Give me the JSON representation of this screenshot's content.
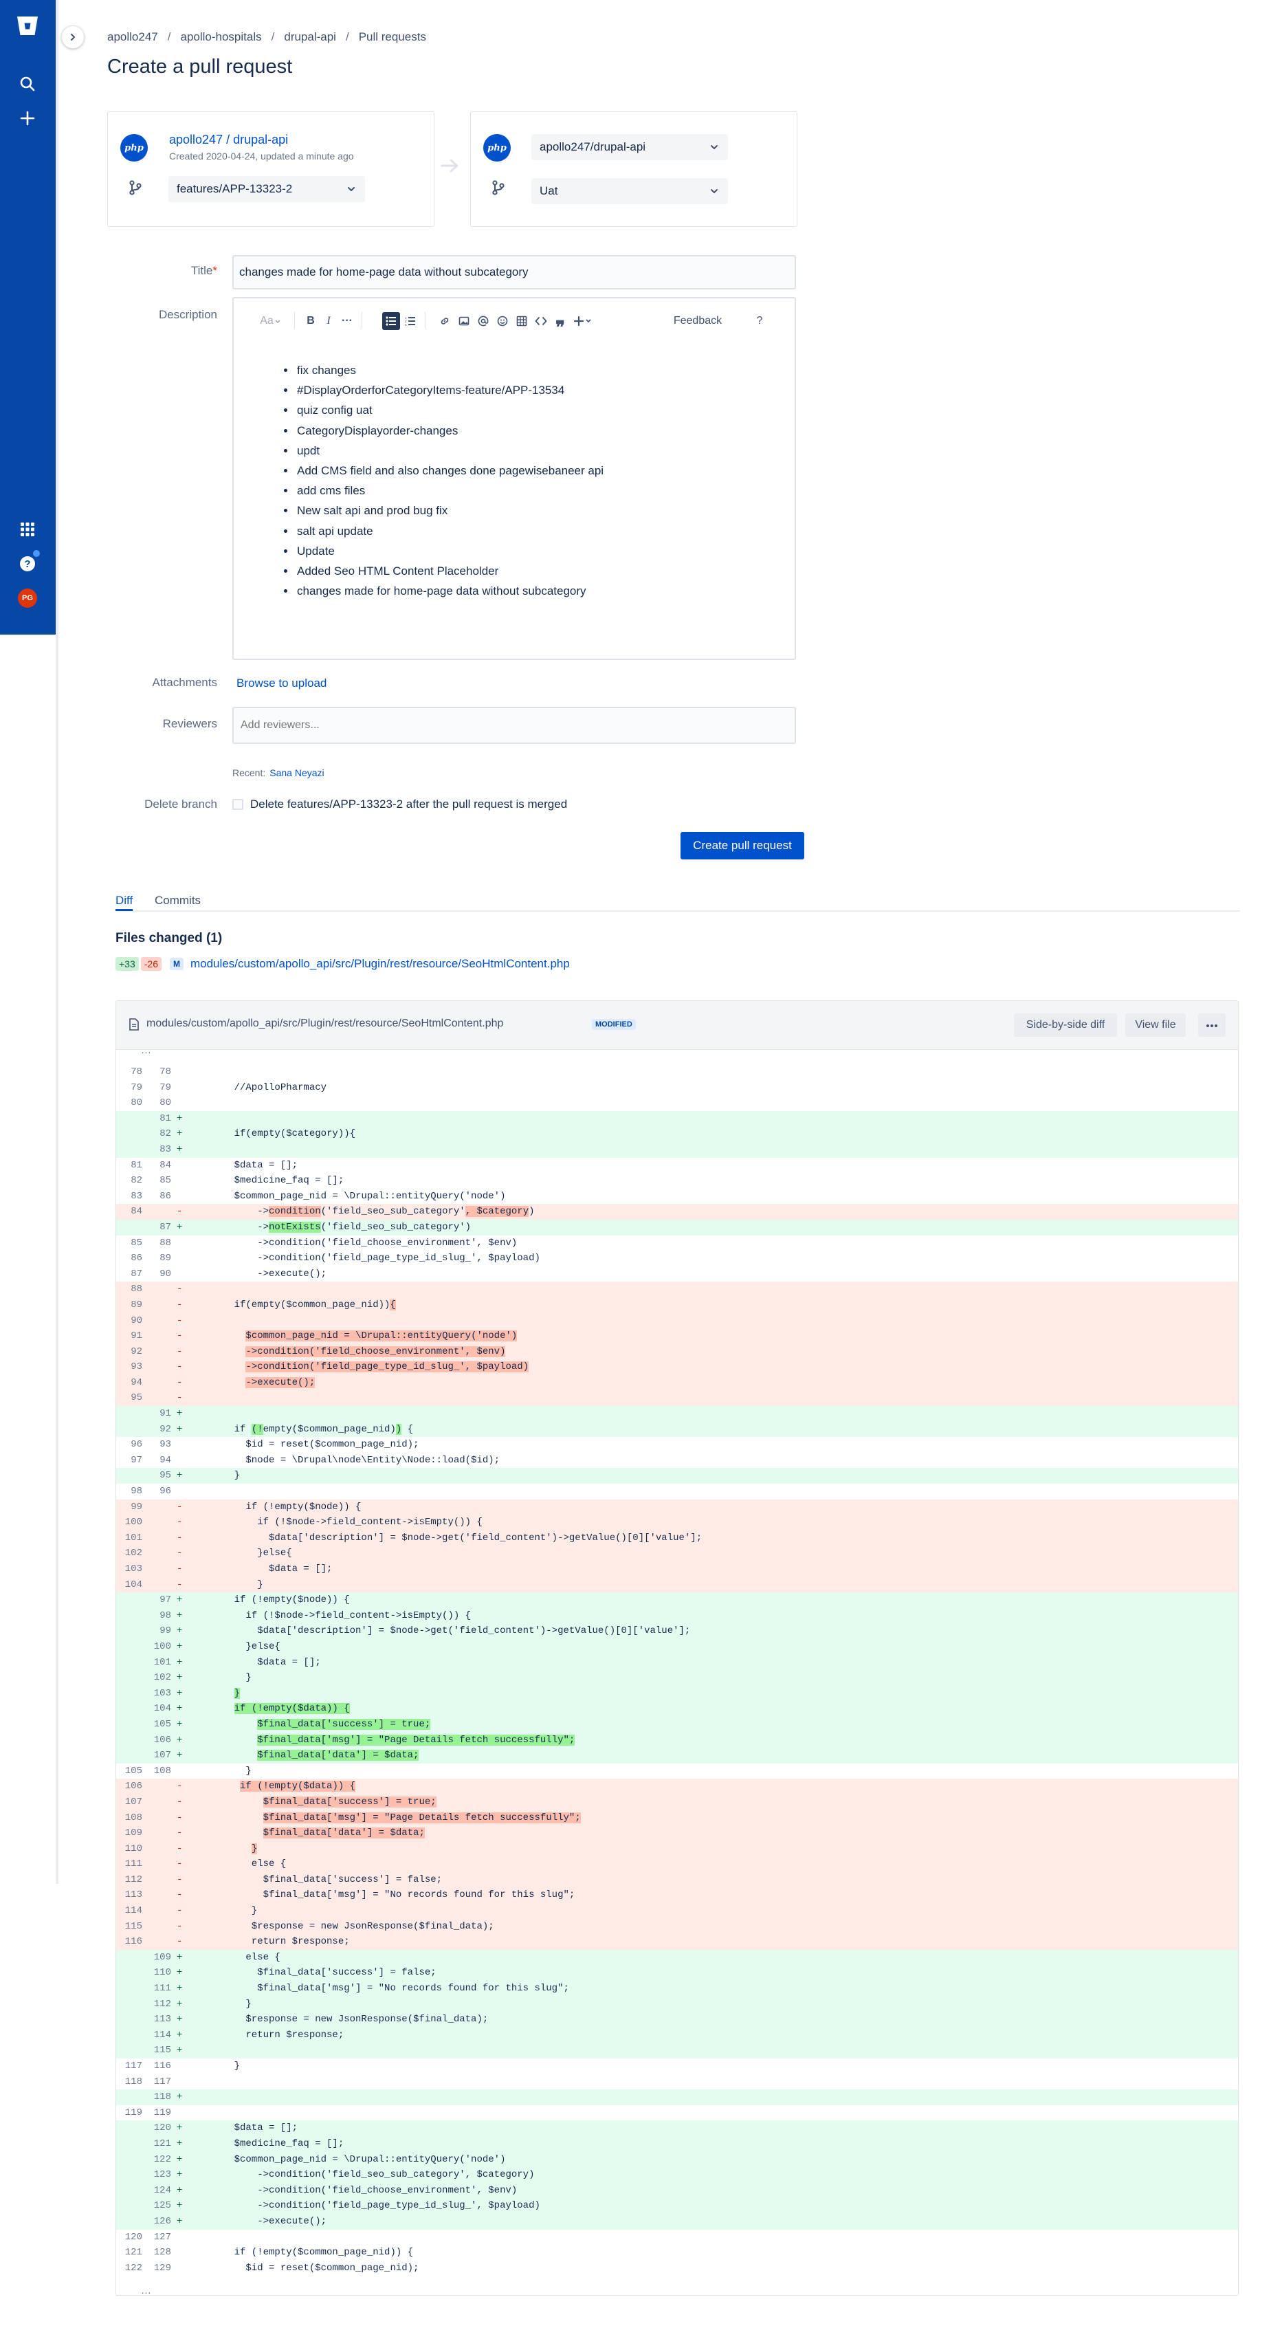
{
  "sidebar": {
    "logo_icon": "bitbucket-logo-icon",
    "search_icon": "search-icon",
    "create_icon": "plus-icon",
    "apps_icon": "app-switcher-icon",
    "help_icon": "help-icon",
    "avatar_initials": "PG",
    "brand_color": "#0747A6"
  },
  "breadcrumb": [
    "apollo247",
    "apollo-hospitals",
    "drupal-api",
    "Pull requests"
  ],
  "page_title": "Create a pull request",
  "source": {
    "workspace": "apollo247",
    "repo": "drupal-api",
    "meta": "Created 2020-04-24, updated a minute ago",
    "branch": "features/APP-13323-2"
  },
  "destination": {
    "repo": "apollo247/drupal-api",
    "branch": "Uat"
  },
  "form": {
    "title_label": "Title",
    "title_value": "changes made for home-page data without subcategory",
    "description_label": "Description",
    "attachments_label": "Attachments",
    "browse_link": "Browse to upload",
    "reviewers_label": "Reviewers",
    "reviewers_placeholder": "Add reviewers...",
    "recent_label": "Recent:",
    "recent_user": "Sana Neyazi",
    "delete_branch_label": "Delete branch",
    "delete_branch_text": "Delete features/APP-13323-2 after the pull request is merged",
    "create_button": "Create pull request"
  },
  "editor_toolbar": {
    "text_style": "Aa",
    "feedback": "Feedback",
    "help": "?"
  },
  "description_items": [
    "fix changes",
    "#DisplayOrderforCategoryItems-feature/APP-13534",
    "quiz config uat",
    "CategoryDisplayorder-changes",
    "updt",
    "Add CMS field and also changes done pagewisebaneer api",
    "add cms files",
    "New salt api and prod bug fix",
    "salt api update",
    "Update",
    "Added Seo HTML Content Placeholder",
    "changes made for home-page data without subcategory"
  ],
  "tabs": [
    "Diff",
    "Commits"
  ],
  "files_changed_title": "Files changed (1)",
  "file": {
    "additions": "+33",
    "deletions": "-26",
    "status_letter": "M",
    "path": "modules/custom/apollo_api/src/Plugin/rest/resource/SeoHtmlContent.php",
    "status_badge": "MODIFIED",
    "side_by_side_button": "Side-by-side diff",
    "view_file_button": "View file",
    "more_icon": "more-icon",
    "expand_dots": "..."
  },
  "diff_lines": [
    {
      "o": "78",
      "n": "78",
      "t": "ctx",
      "c": ""
    },
    {
      "o": "79",
      "n": "79",
      "t": "ctx",
      "c": "    //ApolloPharmacy"
    },
    {
      "o": "80",
      "n": "80",
      "t": "ctx",
      "c": ""
    },
    {
      "o": "",
      "n": "81",
      "t": "add",
      "c": ""
    },
    {
      "o": "",
      "n": "82",
      "t": "add",
      "c": "    if(empty($category)){"
    },
    {
      "o": "",
      "n": "83",
      "t": "add",
      "c": ""
    },
    {
      "o": "81",
      "n": "84",
      "t": "ctx",
      "c": "    $data = [];"
    },
    {
      "o": "82",
      "n": "85",
      "t": "ctx",
      "c": "    $medicine_faq = [];"
    },
    {
      "o": "83",
      "n": "86",
      "t": "ctx",
      "c": "    $common_page_nid = \\Drupal::entityQuery('node')"
    },
    {
      "o": "84",
      "n": "",
      "t": "del",
      "p": [
        "        ->",
        {
          "h": "condition"
        },
        "('field_seo_sub_category'",
        {
          "h": ", $category"
        },
        ")"
      ]
    },
    {
      "o": "",
      "n": "87",
      "t": "add",
      "p": [
        "        ->",
        {
          "h": "notExists"
        },
        "('field_seo_sub_category')"
      ]
    },
    {
      "o": "85",
      "n": "88",
      "t": "ctx",
      "c": "        ->condition('field_choose_environment', $env)"
    },
    {
      "o": "86",
      "n": "89",
      "t": "ctx",
      "c": "        ->condition('field_page_type_id_slug_', $payload)"
    },
    {
      "o": "87",
      "n": "90",
      "t": "ctx",
      "c": "        ->execute();"
    },
    {
      "o": "88",
      "n": "",
      "t": "del",
      "c": ""
    },
    {
      "o": "89",
      "n": "",
      "t": "del",
      "p": [
        "    if(empty($common_page_nid))",
        {
          "h": "{"
        }
      ]
    },
    {
      "o": "90",
      "n": "",
      "t": "del",
      "c": ""
    },
    {
      "o": "91",
      "n": "",
      "t": "del",
      "p": [
        "      ",
        {
          "h": "$common_page_nid = \\Drupal::entityQuery('node')"
        }
      ]
    },
    {
      "o": "92",
      "n": "",
      "t": "del",
      "p": [
        "      ",
        {
          "h": "->condition('field_choose_environment', $env)"
        }
      ]
    },
    {
      "o": "93",
      "n": "",
      "t": "del",
      "p": [
        "      ",
        {
          "h": "->condition('field_page_type_id_slug_', $payload)"
        }
      ]
    },
    {
      "o": "94",
      "n": "",
      "t": "del",
      "p": [
        "      ",
        {
          "h": "->execute();"
        }
      ]
    },
    {
      "o": "95",
      "n": "",
      "t": "del",
      "c": ""
    },
    {
      "o": "",
      "n": "91",
      "t": "add",
      "c": ""
    },
    {
      "o": "",
      "n": "92",
      "t": "add",
      "p": [
        "    if ",
        {
          "h": "(!"
        },
        "empty($common_page_nid)",
        {
          "h": ")"
        },
        " {"
      ]
    },
    {
      "o": "96",
      "n": "93",
      "t": "ctx",
      "c": "      $id = reset($common_page_nid);"
    },
    {
      "o": "97",
      "n": "94",
      "t": "ctx",
      "c": "      $node = \\Drupal\\node\\Entity\\Node::load($id);"
    },
    {
      "o": "",
      "n": "95",
      "t": "add",
      "c": "    }"
    },
    {
      "o": "98",
      "n": "96",
      "t": "ctx",
      "c": ""
    },
    {
      "o": "99",
      "n": "",
      "t": "del",
      "c": "      if (!empty($node)) {"
    },
    {
      "o": "100",
      "n": "",
      "t": "del",
      "c": "        if (!$node->field_content->isEmpty()) {"
    },
    {
      "o": "101",
      "n": "",
      "t": "del",
      "c": "          $data['description'] = $node->get('field_content')->getValue()[0]['value'];"
    },
    {
      "o": "102",
      "n": "",
      "t": "del",
      "c": "        }else{"
    },
    {
      "o": "103",
      "n": "",
      "t": "del",
      "c": "          $data = [];"
    },
    {
      "o": "104",
      "n": "",
      "t": "del",
      "c": "        }"
    },
    {
      "o": "",
      "n": "97",
      "t": "add",
      "c": "    if (!empty($node)) {"
    },
    {
      "o": "",
      "n": "98",
      "t": "add",
      "c": "      if (!$node->field_content->isEmpty()) {"
    },
    {
      "o": "",
      "n": "99",
      "t": "add",
      "c": "        $data['description'] = $node->get('field_content')->getValue()[0]['value'];"
    },
    {
      "o": "",
      "n": "100",
      "t": "add",
      "c": "      }else{"
    },
    {
      "o": "",
      "n": "101",
      "t": "add",
      "c": "        $data = [];"
    },
    {
      "o": "",
      "n": "102",
      "t": "add",
      "c": "      }"
    },
    {
      "o": "",
      "n": "103",
      "t": "add",
      "p": [
        "    ",
        {
          "h": "}"
        }
      ]
    },
    {
      "o": "",
      "n": "104",
      "t": "add",
      "p": [
        "    ",
        {
          "h": "if (!empty($data)) {"
        }
      ]
    },
    {
      "o": "",
      "n": "105",
      "t": "add",
      "p": [
        "        ",
        {
          "h": "$final_data['success'] = true;"
        }
      ]
    },
    {
      "o": "",
      "n": "106",
      "t": "add",
      "p": [
        "        ",
        {
          "h": "$final_data['msg'] = \"Page Details fetch successfully\";"
        }
      ]
    },
    {
      "o": "",
      "n": "107",
      "t": "add",
      "p": [
        "        ",
        {
          "h": "$final_data['data'] = $data;"
        }
      ]
    },
    {
      "o": "105",
      "n": "108",
      "t": "ctx",
      "c": "      }"
    },
    {
      "o": "106",
      "n": "",
      "t": "del",
      "p": [
        "     ",
        {
          "h": "if (!empty($data)) {"
        }
      ]
    },
    {
      "o": "107",
      "n": "",
      "t": "del",
      "p": [
        "         ",
        {
          "h": "$final_data['success'] = true;"
        }
      ]
    },
    {
      "o": "108",
      "n": "",
      "t": "del",
      "p": [
        "         ",
        {
          "h": "$final_data['msg'] = \"Page Details fetch successfully\";"
        }
      ]
    },
    {
      "o": "109",
      "n": "",
      "t": "del",
      "p": [
        "         ",
        {
          "h": "$final_data['data'] = $data;"
        }
      ]
    },
    {
      "o": "110",
      "n": "",
      "t": "del",
      "p": [
        "       ",
        {
          "h": "}"
        }
      ]
    },
    {
      "o": "111",
      "n": "",
      "t": "del",
      "c": "       else {"
    },
    {
      "o": "112",
      "n": "",
      "t": "del",
      "c": "         $final_data['success'] = false;"
    },
    {
      "o": "113",
      "n": "",
      "t": "del",
      "c": "         $final_data['msg'] = \"No records found for this slug\";"
    },
    {
      "o": "114",
      "n": "",
      "t": "del",
      "c": "       }"
    },
    {
      "o": "115",
      "n": "",
      "t": "del",
      "c": "       $response = new JsonResponse($final_data);"
    },
    {
      "o": "116",
      "n": "",
      "t": "del",
      "c": "       return $response;"
    },
    {
      "o": "",
      "n": "109",
      "t": "add",
      "c": "      else {"
    },
    {
      "o": "",
      "n": "110",
      "t": "add",
      "c": "        $final_data['success'] = false;"
    },
    {
      "o": "",
      "n": "111",
      "t": "add",
      "c": "        $final_data['msg'] = \"No records found for this slug\";"
    },
    {
      "o": "",
      "n": "112",
      "t": "add",
      "c": "      }"
    },
    {
      "o": "",
      "n": "113",
      "t": "add",
      "c": "      $response = new JsonResponse($final_data);"
    },
    {
      "o": "",
      "n": "114",
      "t": "add",
      "c": "      return $response;"
    },
    {
      "o": "",
      "n": "115",
      "t": "add",
      "c": ""
    },
    {
      "o": "117",
      "n": "116",
      "t": "ctx",
      "c": "    }"
    },
    {
      "o": "118",
      "n": "117",
      "t": "ctx",
      "c": ""
    },
    {
      "o": "",
      "n": "118",
      "t": "add",
      "c": ""
    },
    {
      "o": "119",
      "n": "119",
      "t": "ctx",
      "c": ""
    },
    {
      "o": "",
      "n": "120",
      "t": "add",
      "c": "    $data = [];"
    },
    {
      "o": "",
      "n": "121",
      "t": "add",
      "c": "    $medicine_faq = [];"
    },
    {
      "o": "",
      "n": "122",
      "t": "add",
      "c": "    $common_page_nid = \\Drupal::entityQuery('node')"
    },
    {
      "o": "",
      "n": "123",
      "t": "add",
      "c": "        ->condition('field_seo_sub_category', $category)"
    },
    {
      "o": "",
      "n": "124",
      "t": "add",
      "c": "        ->condition('field_choose_environment', $env)"
    },
    {
      "o": "",
      "n": "125",
      "t": "add",
      "c": "        ->condition('field_page_type_id_slug_', $payload)"
    },
    {
      "o": "",
      "n": "126",
      "t": "add",
      "c": "        ->execute();"
    },
    {
      "o": "120",
      "n": "127",
      "t": "ctx",
      "c": ""
    },
    {
      "o": "121",
      "n": "128",
      "t": "ctx",
      "c": "    if (!empty($common_page_nid)) {"
    },
    {
      "o": "122",
      "n": "129",
      "t": "ctx",
      "c": "      $id = reset($common_page_nid);"
    }
  ]
}
